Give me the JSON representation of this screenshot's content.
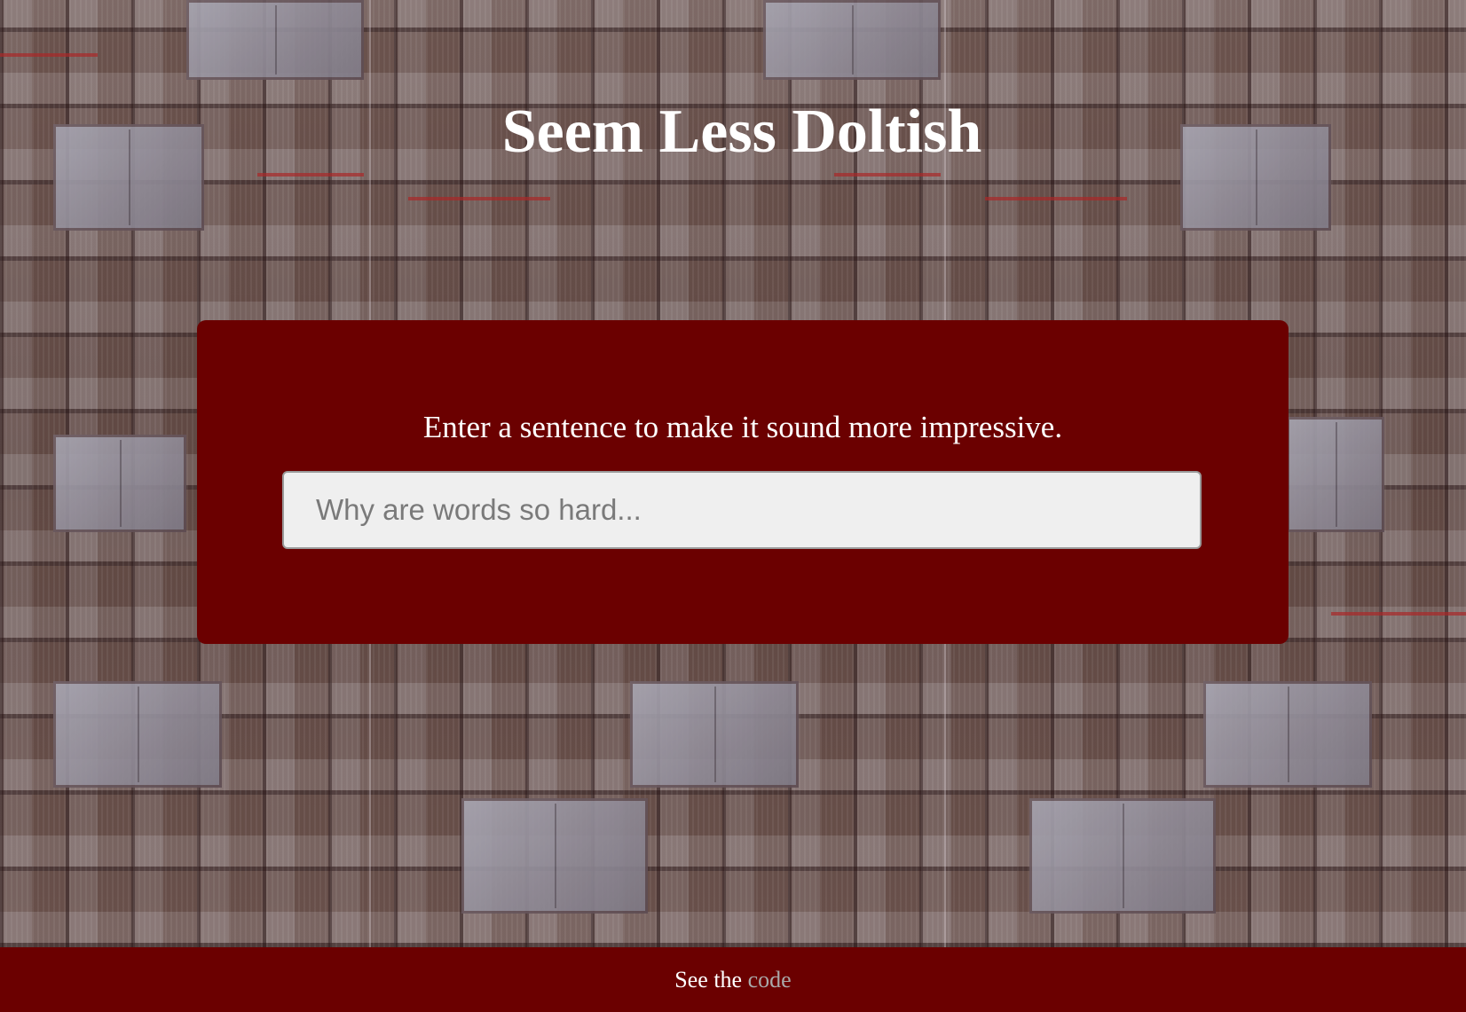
{
  "page": {
    "title": "Seem Less Doltish",
    "background": "open-books-wall"
  },
  "card": {
    "prompt": "Enter a sentence to make it sound more impressive.",
    "input": {
      "value": "",
      "placeholder": "Why are words so hard..."
    }
  },
  "footer": {
    "prefix": "See the",
    "link_label": "code"
  },
  "colors": {
    "accent": "#6b0000",
    "text": "#ffffff",
    "link": "#a9a9a9",
    "input_bg": "#efefef"
  }
}
